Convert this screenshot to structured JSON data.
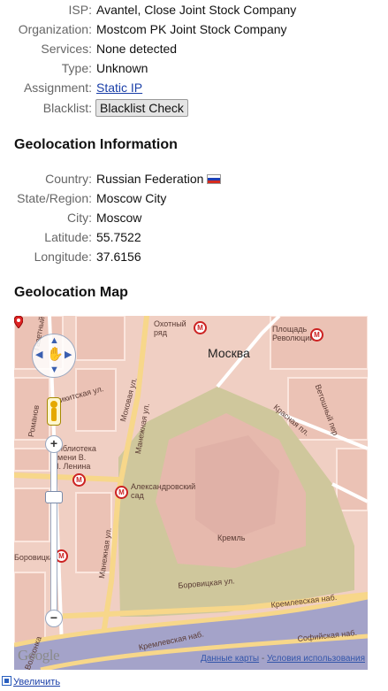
{
  "info": {
    "isp_label": "ISP:",
    "isp_value": "Avantel, Close Joint Stock Company",
    "org_label": "Organization:",
    "org_value": "Mostcom PK Joint Stock Company",
    "services_label": "Services:",
    "services_value": "None detected",
    "type_label": "Type:",
    "type_value": "Unknown",
    "assignment_label": "Assignment:",
    "assignment_value": "Static IP",
    "blacklist_label": "Blacklist:",
    "blacklist_button": "Blacklist Check"
  },
  "geo": {
    "title": "Geolocation Information",
    "country_label": "Country:",
    "country_value": "Russian Federation",
    "region_label": "State/Region:",
    "region_value": "Moscow City",
    "city_label": "City:",
    "city_value": "Moscow",
    "lat_label": "Latitude:",
    "lat_value": "55.7522",
    "lon_label": "Longitude:",
    "lon_value": "37.6156"
  },
  "map": {
    "title": "Geolocation Map",
    "city_label": "Москва",
    "labels": {
      "okhotny": "Охотный\nряд",
      "ploshad": "Площадь\nРеволюции",
      "vetoshny": "Ветошный пер",
      "krasnaya": "Красная пл.",
      "nikitskaya": "Никитская ул.",
      "mokhovaya": "Моховая ул.",
      "manezhnaya1": "Манежная ул.",
      "manezhnaya2": "Манежная ул.",
      "romanov": "Романов",
      "gaz": "Газетный",
      "library": "Библиотека\nимени В.\nИ. Ленина",
      "alexandrovsky": "Александровский\nсад",
      "borovitskaya": "Боровицкая",
      "kreml": "Кремль",
      "borovitskaya_ul": "Боровицкая ул.",
      "kremlevskaya1": "Кремлевская наб.",
      "kremlevskaya2": "Кремлевская наб.",
      "sofiyskaya": "Софийская наб.",
      "volkhonka": "Волхонка"
    },
    "google": "Google",
    "data_link": "Данные карты",
    "separator": " - ",
    "terms_link": "Условия использования"
  },
  "enlarge_link": "Увеличить"
}
